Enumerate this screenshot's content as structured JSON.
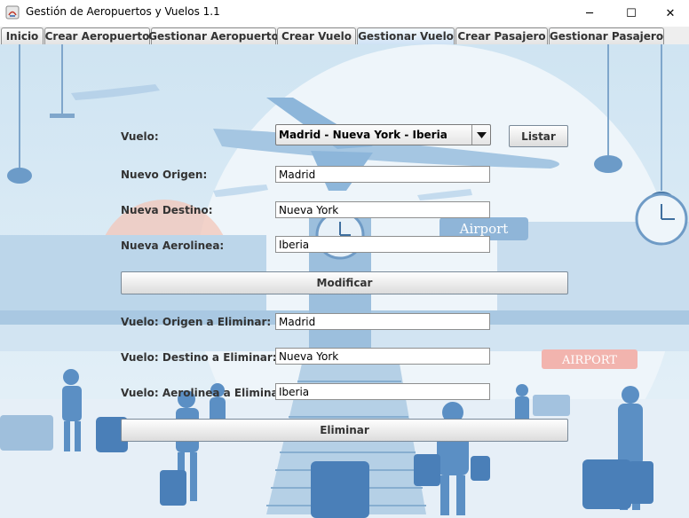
{
  "window": {
    "title": "Gestión de Aeropuertos y Vuelos 1.1",
    "minimize_glyph": "─",
    "maximize_glyph": "☐",
    "close_glyph": "✕"
  },
  "tabs": [
    {
      "label": "Inicio",
      "active": false
    },
    {
      "label": "Crear Aeropuerto",
      "active": false
    },
    {
      "label": "Gestionar Aeropuerto",
      "active": false
    },
    {
      "label": "Crear Vuelo",
      "active": false
    },
    {
      "label": "Gestionar Vuelo",
      "active": true
    },
    {
      "label": "Crear Pasajero",
      "active": false
    },
    {
      "label": "Gestionar Pasajero",
      "active": false
    }
  ],
  "form": {
    "vuelo_label": "Vuelo:",
    "vuelo_selected": "Madrid - Nueva York - Iberia",
    "listar_label": "Listar",
    "origen_label": "Nuevo Origen:",
    "origen_value": "Madrid",
    "destino_label": "Nueva Destino:",
    "destino_value": "Nueva York",
    "aerolinea_label": "Nueva Aerolinea:",
    "aerolinea_value": "Iberia",
    "modificar_label": "Modificar",
    "el_origen_label": "Vuelo: Origen a Eliminar:",
    "el_origen_value": "Madrid",
    "el_destino_label": "Vuelo: Destino a Eliminar:",
    "el_destino_value": "Nueva York",
    "el_aerolinea_label": "Vuelo: Aerolinea a Eliminar:",
    "el_aerolinea_value": "Iberia",
    "eliminar_label": "Eliminar"
  },
  "background": {
    "sign_left": "Airport",
    "sign_right": "AIRPORT"
  },
  "colors": {
    "sky": "#dcecf6",
    "accent_blue": "#5b8fc4",
    "dark_blue": "#2f5f94",
    "sun": "#f3c6b8"
  }
}
